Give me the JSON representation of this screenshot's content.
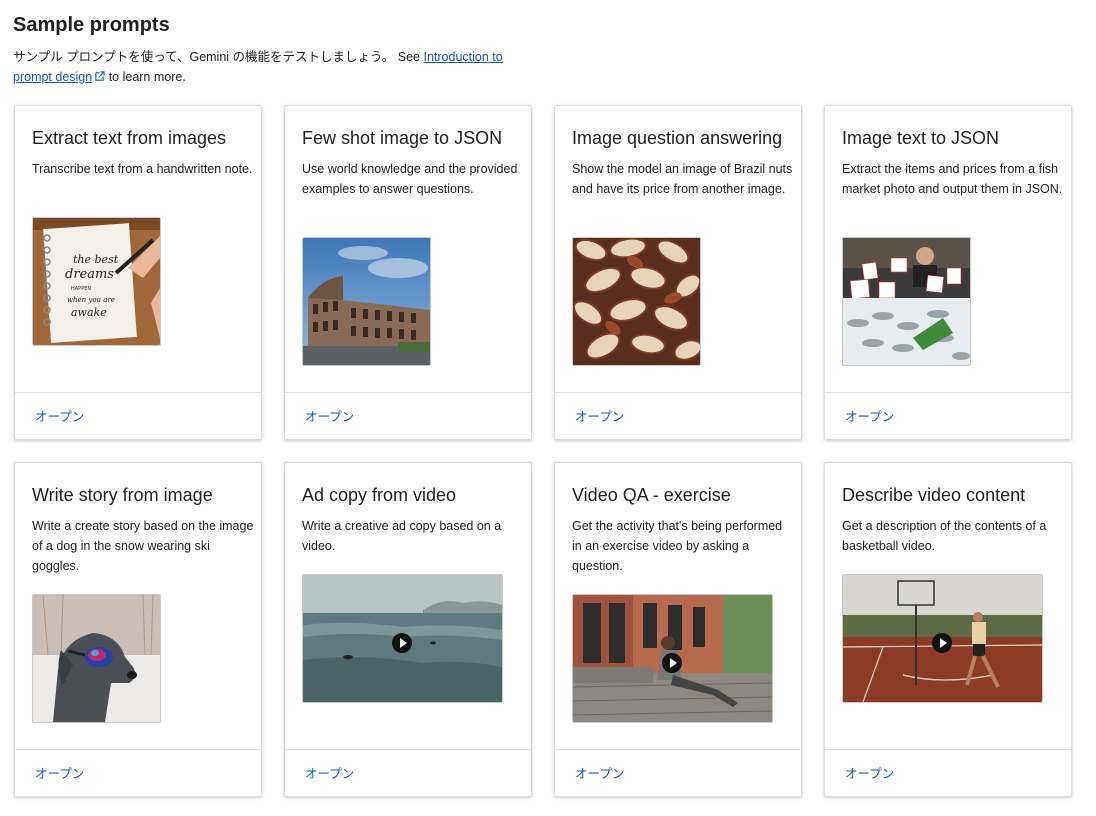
{
  "header": {
    "title": "Sample prompts",
    "intro_text": "サンプル プロンプトを使って、Gemini の機能をテストしましょう。 See ",
    "intro_link": "Introduction to prompt design",
    "intro_suffix": " to learn more."
  },
  "cards": [
    {
      "title": "Extract text from images",
      "description": "Transcribe text from a handwritten note.",
      "action": "オープン"
    },
    {
      "title": "Few shot image to JSON",
      "description": "Use world knowledge and the provided examples to answer questions.",
      "action": "オープン"
    },
    {
      "title": "Image question answering",
      "description": "Show the model an image of Brazil nuts and have its price from another image.",
      "action": "オープン"
    },
    {
      "title": "Image text to JSON",
      "description": "Extract the items and prices from a fish market photo and output them in JSON.",
      "action": "オープン"
    },
    {
      "title": "Write story from image",
      "description": "Write a create story based on the image of a dog in the snow wearing ski goggles.",
      "action": "オープン"
    },
    {
      "title": "Ad copy from video",
      "description": "Write a creative ad copy based on a video.",
      "action": "オープン"
    },
    {
      "title": "Video QA - exercise",
      "description": "Get the activity that's being performed in an exercise video by asking a question.",
      "action": "オープン"
    },
    {
      "title": "Describe video content",
      "description": "Get a description of the contents of a basketball video.",
      "action": "オープン"
    }
  ],
  "colors": {
    "link": "#1a55b8",
    "border": "#dadce0"
  },
  "icons": {
    "external_link": "external-link-icon",
    "play": "play-icon"
  }
}
